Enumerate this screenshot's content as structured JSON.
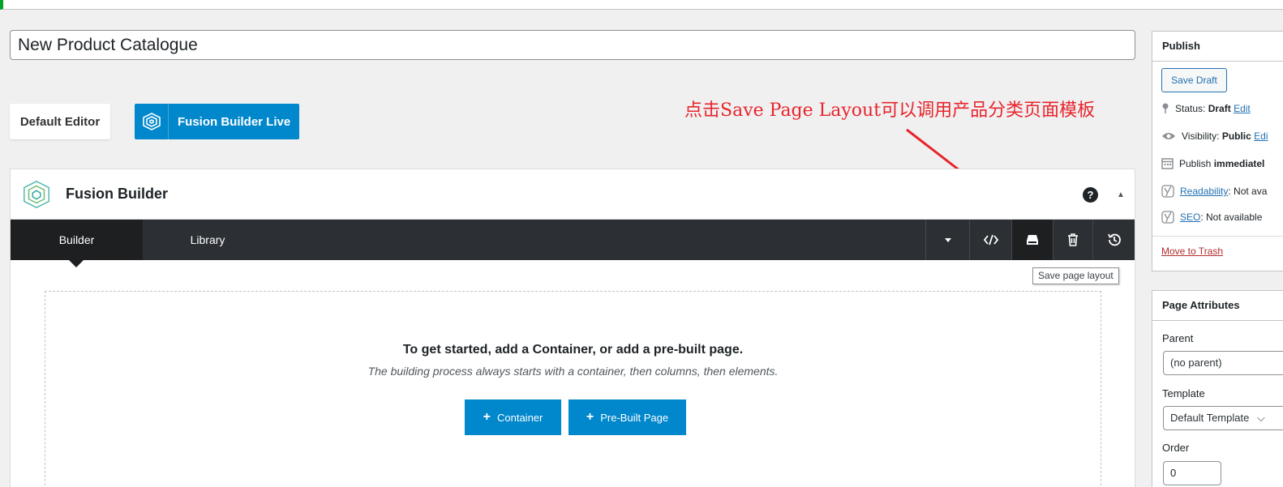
{
  "page": {
    "title_value": "New Product Catalogue"
  },
  "editor_switch": {
    "default_editor": "Default Editor",
    "fusion_live": "Fusion Builder Live"
  },
  "annotation": {
    "text": "点击Save Page Layout可以调用产品分类页面模板",
    "color": "#e8242b"
  },
  "fusion_builder": {
    "title": "Fusion Builder",
    "help": "?",
    "tabs": [
      {
        "label": "Builder",
        "active": true
      },
      {
        "label": "Library",
        "active": false
      }
    ],
    "toolbar_icons": [
      "caret-down-icon",
      "code-icon",
      "save-layout-icon",
      "trash-icon",
      "history-icon"
    ],
    "tooltip": "Save page layout",
    "empty_state": {
      "heading": "To get started, add a Container, or add a pre-built page.",
      "subheading": "The building process always starts with a container, then columns, then elements.",
      "container_button": "Container",
      "prebuilt_button": "Pre-Built Page"
    }
  },
  "publish": {
    "title": "Publish",
    "save_draft": "Save Draft",
    "status_label": "Status:",
    "status_value": "Draft",
    "status_edit": "Edit",
    "visibility_label": "Visibility:",
    "visibility_value": "Public",
    "visibility_edit": "Edi",
    "publish_label": "Publish",
    "publish_value": "immediatel",
    "readability_link": "Readability",
    "readability_value": ": Not ava",
    "seo_link": "SEO",
    "seo_value": ": Not available",
    "trash": "Move to Trash"
  },
  "page_attributes": {
    "title": "Page Attributes",
    "parent_label": "Parent",
    "parent_value": "(no parent)",
    "template_label": "Template",
    "template_value": "Default Template",
    "order_label": "Order",
    "order_value": "0"
  },
  "colors": {
    "accent_blue": "#0087cc",
    "toolbar_dark": "#2c2f33",
    "wp_link": "#2271b1"
  }
}
